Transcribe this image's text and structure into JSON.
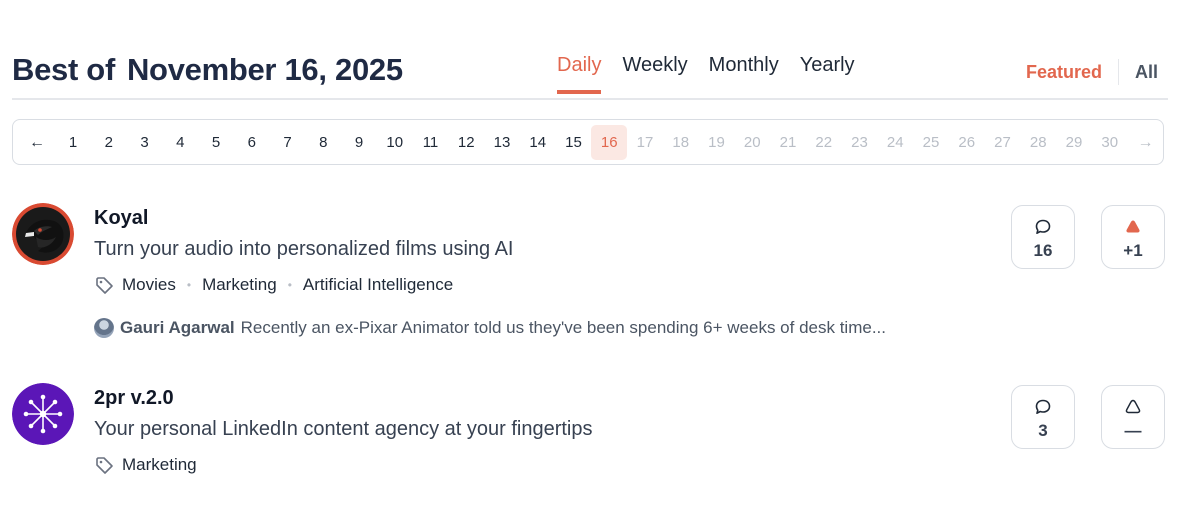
{
  "header": {
    "title_prefix": "Best of",
    "title_date": "November 16, 2025",
    "tabs": [
      {
        "label": "Daily",
        "active": true
      },
      {
        "label": "Weekly",
        "active": false
      },
      {
        "label": "Monthly",
        "active": false
      },
      {
        "label": "Yearly",
        "active": false
      }
    ],
    "filters": {
      "featured": "Featured",
      "all": "All"
    }
  },
  "pagination": {
    "prev_icon": "←",
    "next_icon": "→",
    "current": 16,
    "pages": [
      "1",
      "2",
      "3",
      "4",
      "5",
      "6",
      "7",
      "8",
      "9",
      "10",
      "11",
      "12",
      "13",
      "14",
      "15",
      "16",
      "17",
      "18",
      "19",
      "20",
      "21",
      "22",
      "23",
      "24",
      "25",
      "26",
      "27",
      "28",
      "29",
      "30"
    ]
  },
  "posts": [
    {
      "name": "Koyal",
      "tagline": "Turn your audio into personalized films using AI",
      "logo_icon": "bird-logo-icon",
      "tags": [
        "Movies",
        "Marketing",
        "Artificial Intelligence"
      ],
      "comment": {
        "author": "Gauri Agarwal",
        "text": "Recently an ex-Pixar Animator told us they've been spending 6+ weeks of desk time..."
      },
      "comments_count": "16",
      "votes": "+1",
      "upvoted": true
    },
    {
      "name": "2pr v.2.0",
      "tagline": "Your personal LinkedIn content agency at your fingertips",
      "logo_icon": "network-logo-icon",
      "tags": [
        "Marketing"
      ],
      "comments_count": "3",
      "votes": "—",
      "upvoted": false
    }
  ],
  "colors": {
    "accent": "#e2674e",
    "accent_light": "#fbe8e3",
    "border": "#d9dde3",
    "title": "#1f2a44"
  }
}
